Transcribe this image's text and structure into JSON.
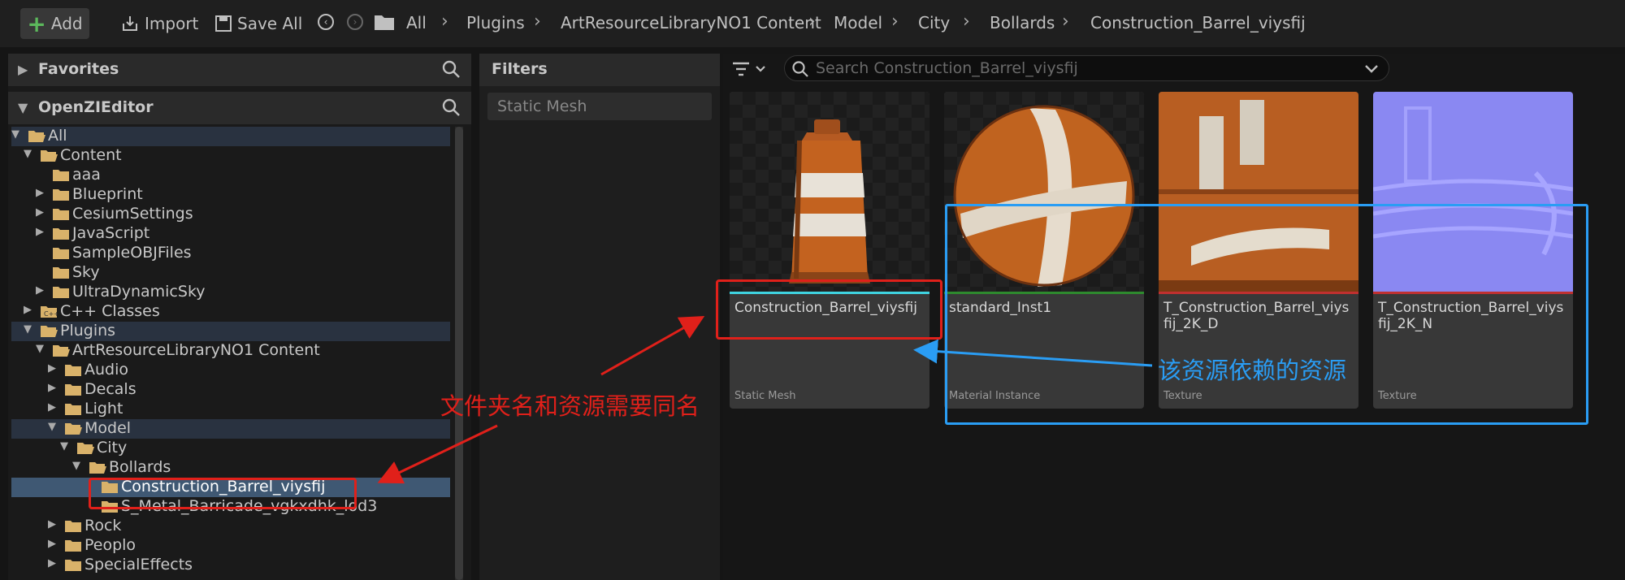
{
  "toolbar": {
    "add_label": "Add",
    "import_label": "Import",
    "save_all_label": "Save All"
  },
  "breadcrumb": [
    "All",
    "Plugins",
    "ArtResourceLibraryNO1 Content",
    "Model",
    "City",
    "Bollards",
    "Construction_Barrel_viysfij"
  ],
  "sidebar": {
    "favorites_label": "Favorites",
    "project_label": "OpenZIEditor",
    "tree": [
      {
        "label": "All"
      },
      {
        "label": "Content"
      },
      {
        "label": "aaa"
      },
      {
        "label": "Blueprint"
      },
      {
        "label": "CesiumSettings"
      },
      {
        "label": "JavaScript"
      },
      {
        "label": "SampleOBJFiles"
      },
      {
        "label": "Sky"
      },
      {
        "label": "UltraDynamicSky"
      },
      {
        "label": "C++ Classes"
      },
      {
        "label": "Plugins"
      },
      {
        "label": "ArtResourceLibraryNO1 Content"
      },
      {
        "label": "Audio"
      },
      {
        "label": "Decals"
      },
      {
        "label": "Light"
      },
      {
        "label": "Model"
      },
      {
        "label": "City"
      },
      {
        "label": "Bollards"
      },
      {
        "label": "Construction_Barrel_viysfij"
      },
      {
        "label": "S_Metal_Barricade_vgkxdhk_lod3"
      },
      {
        "label": "Rock"
      },
      {
        "label": "Peoplo"
      },
      {
        "label": "SpecialEffects"
      }
    ]
  },
  "filters": {
    "header": "Filters",
    "chip": "Static Mesh"
  },
  "search": {
    "placeholder": "Search Construction_Barrel_viysfij"
  },
  "assets": [
    {
      "name": "Construction_Barrel_viysfij",
      "type": "Static Mesh",
      "bar_color": "#3fd3e0"
    },
    {
      "name": "standard_Inst1",
      "type": "Material Instance",
      "bar_color": "#2e8a2e"
    },
    {
      "name": "T_Construction_Barrel_viysfij_2K_D",
      "type": "Texture",
      "bar_color": "#c03030"
    },
    {
      "name": "T_Construction_Barrel_viysfij_2K_N",
      "type": "Texture",
      "bar_color": "#c03030"
    }
  ],
  "annotations": {
    "folder_note": "文件夹名和资源需要同名",
    "dependency_note": "该资源依赖的资源",
    "red_color": "#e0201a",
    "blue_color": "#2a9df4"
  }
}
